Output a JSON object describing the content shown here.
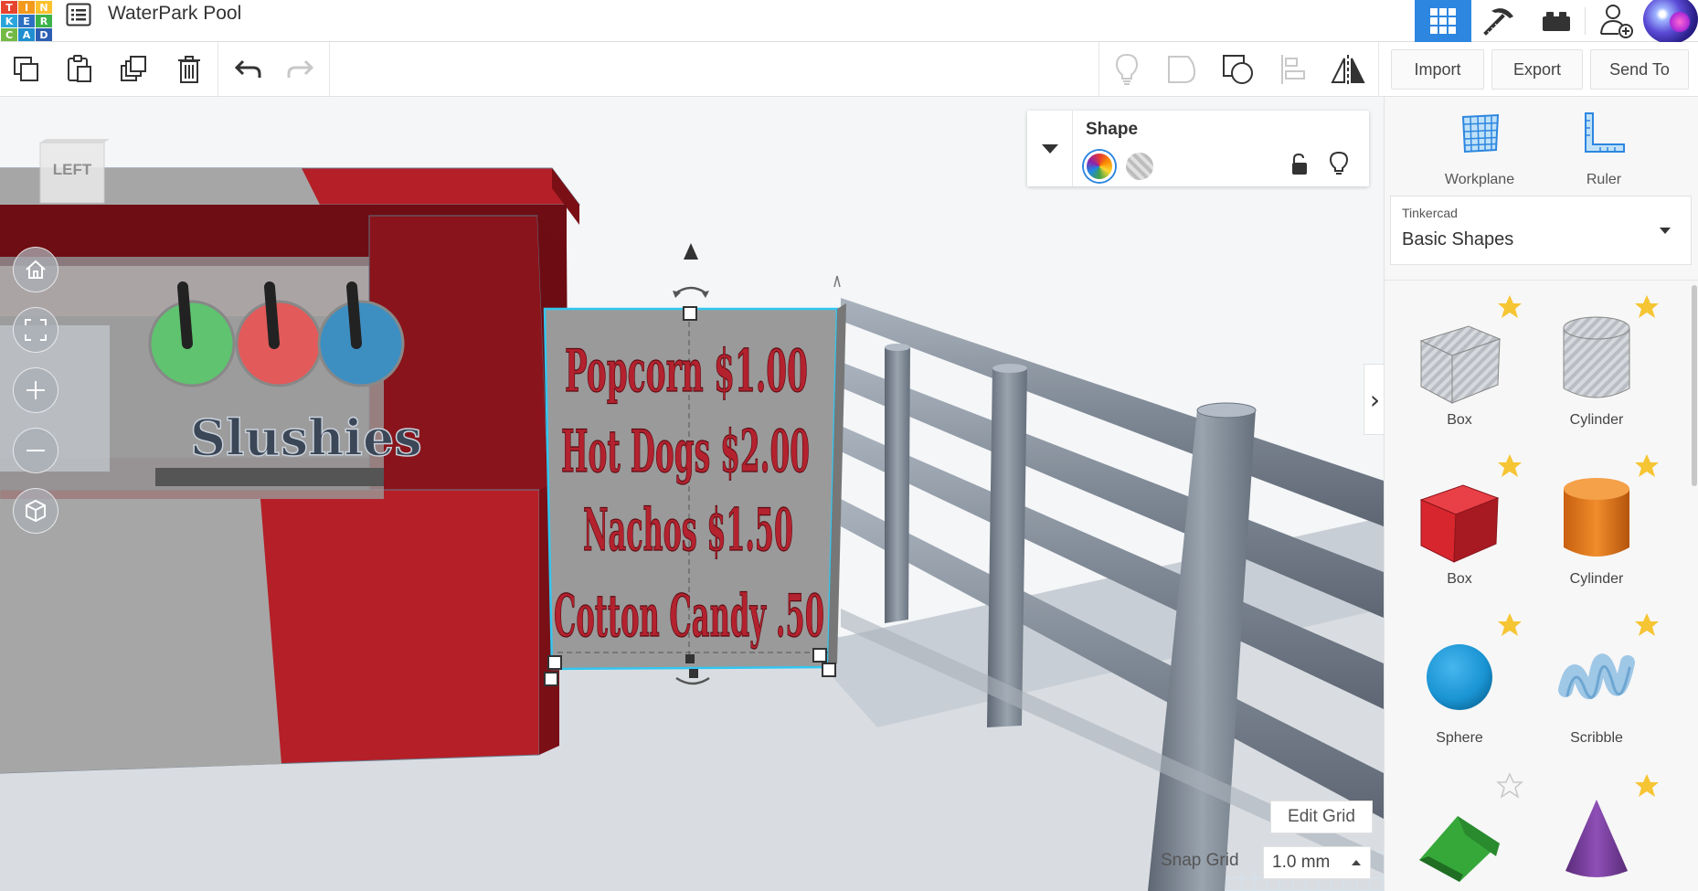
{
  "app": {
    "title": "WaterPark Pool",
    "logo_letters": [
      "T",
      "I",
      "N",
      "K",
      "E",
      "R",
      "C",
      "A",
      "D"
    ],
    "logo_colors": [
      "#e6442f",
      "#f39a1d",
      "#fcc12d",
      "#29a5dc",
      "#2e70c1",
      "#3cb24b",
      "#73ba45",
      "#1f8fd1",
      "#2c5fb3"
    ]
  },
  "topbar": {
    "buttons": [
      {
        "name": "3d-design-grid-icon",
        "active": true
      },
      {
        "name": "pickaxe-icon"
      },
      {
        "name": "bricks-icon"
      },
      {
        "name": "add-user-icon"
      },
      {
        "name": "avatar"
      }
    ]
  },
  "toolbar": {
    "import_label": "Import",
    "export_label": "Export",
    "send_to_label": "Send To"
  },
  "viewport": {
    "nav_cube_label": "LEFT",
    "scene_texts": {
      "slushies": "Slushies",
      "sign_lines": [
        "Popcorn $1.00",
        "Hot Dogs $2.00",
        "Nachos $1.50",
        "Cotton Candy .50"
      ]
    },
    "edit_grid_label": "Edit Grid",
    "snap_grid_label": "Snap Grid",
    "snap_grid_value": "1.0 mm"
  },
  "shape_panel": {
    "title": "Shape",
    "solid_color": "rainbow",
    "hole_color": "striped-gray"
  },
  "right_panel": {
    "tools": [
      {
        "label": "Workplane",
        "icon": "workplane-icon"
      },
      {
        "label": "Ruler",
        "icon": "ruler-icon"
      }
    ],
    "library_provider": "Tinkercad",
    "library_name": "Basic Shapes",
    "shapes": [
      {
        "label": "Box",
        "kind": "box-hole",
        "favorite": true
      },
      {
        "label": "Cylinder",
        "kind": "cylinder-hole",
        "favorite": true
      },
      {
        "label": "Box",
        "kind": "box",
        "color": "#d7262d",
        "favorite": true
      },
      {
        "label": "Cylinder",
        "kind": "cylinder",
        "color": "#e6791e",
        "favorite": true
      },
      {
        "label": "Sphere",
        "kind": "sphere",
        "color": "#1a94d3",
        "favorite": true
      },
      {
        "label": "Scribble",
        "kind": "scribble",
        "color": "#9fc7e6",
        "favorite": true
      },
      {
        "label": "",
        "kind": "roof",
        "color": "#36a83a",
        "favorite": false
      },
      {
        "label": "",
        "kind": "cone",
        "color": "#7a3f9e",
        "favorite": true
      }
    ]
  },
  "colors": {
    "accent": "#2d86e0",
    "kiosk_red": "#8d141c",
    "sign_text": "#b3222e"
  }
}
